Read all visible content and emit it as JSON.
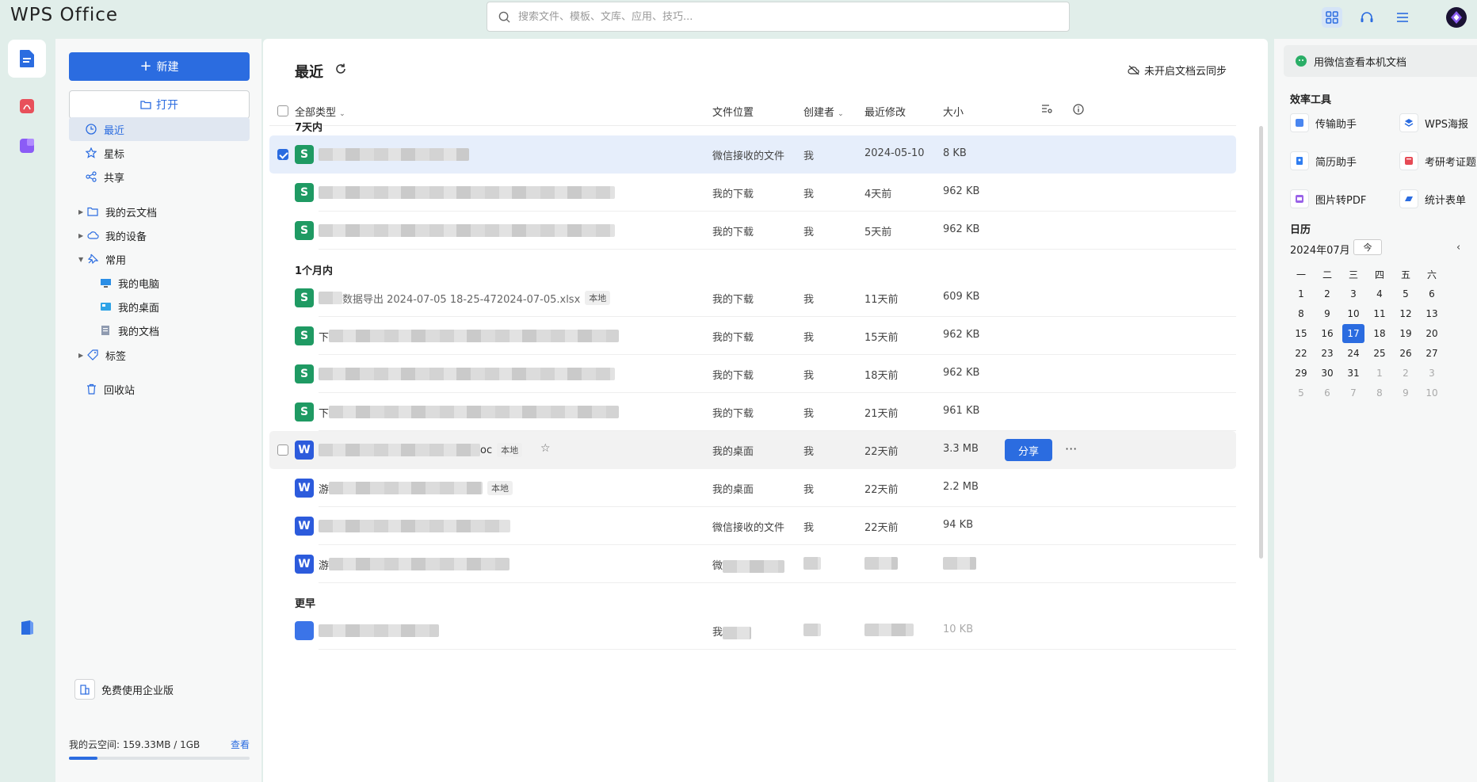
{
  "app": {
    "title": "WPS Office"
  },
  "search": {
    "placeholder": "搜索文件、模板、文库、应用、技巧..."
  },
  "sidebar": {
    "new_label": "新建",
    "open_label": "打开",
    "items": [
      {
        "label": "最近",
        "icon": "clock-icon"
      },
      {
        "label": "星标",
        "icon": "star-icon"
      },
      {
        "label": "共享",
        "icon": "share-icon"
      },
      {
        "label": "我的云文档",
        "icon": "folder-icon"
      },
      {
        "label": "我的设备",
        "icon": "cloud-device-icon"
      },
      {
        "label": "常用",
        "icon": "pin-icon"
      },
      {
        "label": "我的电脑",
        "icon": "computer-icon"
      },
      {
        "label": "我的桌面",
        "icon": "desktop-icon"
      },
      {
        "label": "我的文档",
        "icon": "document-icon"
      },
      {
        "label": "标签",
        "icon": "tag-icon"
      },
      {
        "label": "回收站",
        "icon": "trash-icon"
      }
    ],
    "enterprise_label": "免费使用企业版",
    "storage_label": "我的云空间: 159.33MB / 1GB",
    "storage_link": "查看",
    "storage_fraction": 0.156
  },
  "main": {
    "title": "最近",
    "sync_label": "未开启文档云同步",
    "columns": {
      "type": "全部类型",
      "location": "文件位置",
      "creator": "创建者",
      "modified": "最近修改",
      "size": "大小"
    },
    "groups": [
      "7天内",
      "1个月内",
      "更早"
    ],
    "rows": [
      {
        "type": "sheet",
        "name_prefix": "",
        "tag": "",
        "location": "微信接收的文件",
        "creator": "我",
        "modified": "2024-05-10",
        "size": "8 KB"
      },
      {
        "type": "S",
        "name_prefix": "",
        "tag": "",
        "location": "我的下载",
        "creator": "我",
        "modified": "4天前",
        "size": "962 KB"
      },
      {
        "type": "S",
        "name_prefix": "",
        "tag": "",
        "location": "我的下载",
        "creator": "我",
        "modified": "5天前",
        "size": "962 KB"
      },
      {
        "type": "S",
        "name_prefix": "数据导出 2024-07-05 18-25-472024-07-05.xlsx",
        "tag": "本地",
        "location": "我的下载",
        "creator": "我",
        "modified": "11天前",
        "size": "609 KB"
      },
      {
        "type": "S",
        "name_prefix": "下",
        "tag": "",
        "location": "我的下载",
        "creator": "我",
        "modified": "15天前",
        "size": "962 KB"
      },
      {
        "type": "S",
        "name_prefix": "",
        "tag": "",
        "location": "我的下载",
        "creator": "我",
        "modified": "18天前",
        "size": "962 KB"
      },
      {
        "type": "S",
        "name_prefix": "下",
        "tag": "",
        "location": "我的下载",
        "creator": "我",
        "modified": "21天前",
        "size": "961 KB"
      },
      {
        "type": "W",
        "name_prefix": "oc",
        "tag": "本地",
        "location": "我的桌面",
        "creator": "我",
        "modified": "22天前",
        "size": "3.3 MB"
      },
      {
        "type": "W",
        "name_prefix": "游",
        "tag": "本地",
        "location": "我的桌面",
        "creator": "我",
        "modified": "22天前",
        "size": "2.2 MB"
      },
      {
        "type": "W",
        "name_prefix": "",
        "tag": "",
        "location": "微信接收的文件",
        "creator": "我",
        "modified": "22天前",
        "size": "94 KB"
      },
      {
        "type": "W",
        "name_prefix": "游",
        "tag": "",
        "location": "微",
        "creator": "",
        "modified": "",
        "size": ""
      },
      {
        "type": "doc",
        "name_prefix": "",
        "tag": "",
        "location": "我",
        "creator": "",
        "modified": "",
        "size": "10 KB"
      }
    ],
    "share_label": "分享",
    "more_label": "···"
  },
  "right": {
    "wechat_label": "用微信查看本机文档",
    "tools_title": "效率工具",
    "tools": [
      "传输助手",
      "WPS海报",
      "简历助手",
      "考研考证题",
      "图片转PDF",
      "统计表单"
    ],
    "calendar_title": "日历",
    "calendar_month": "2024年07月",
    "calendar_today_btn": "今",
    "weekdays": [
      "一",
      "二",
      "三",
      "四",
      "五",
      "六"
    ],
    "days": [
      [
        "1",
        "2",
        "3",
        "4",
        "5",
        "6"
      ],
      [
        "8",
        "9",
        "10",
        "11",
        "12",
        "13"
      ],
      [
        "15",
        "16",
        "17",
        "18",
        "19",
        "20"
      ],
      [
        "22",
        "23",
        "24",
        "25",
        "26",
        "27"
      ],
      [
        "29",
        "30",
        "31",
        "1",
        "2",
        "3"
      ],
      [
        "5",
        "6",
        "7",
        "8",
        "9",
        "10"
      ]
    ],
    "today": "17"
  },
  "colors": {
    "accent": "#2b6ce0",
    "sheet": "#1f9a63",
    "writer": "#2c5bdc"
  }
}
